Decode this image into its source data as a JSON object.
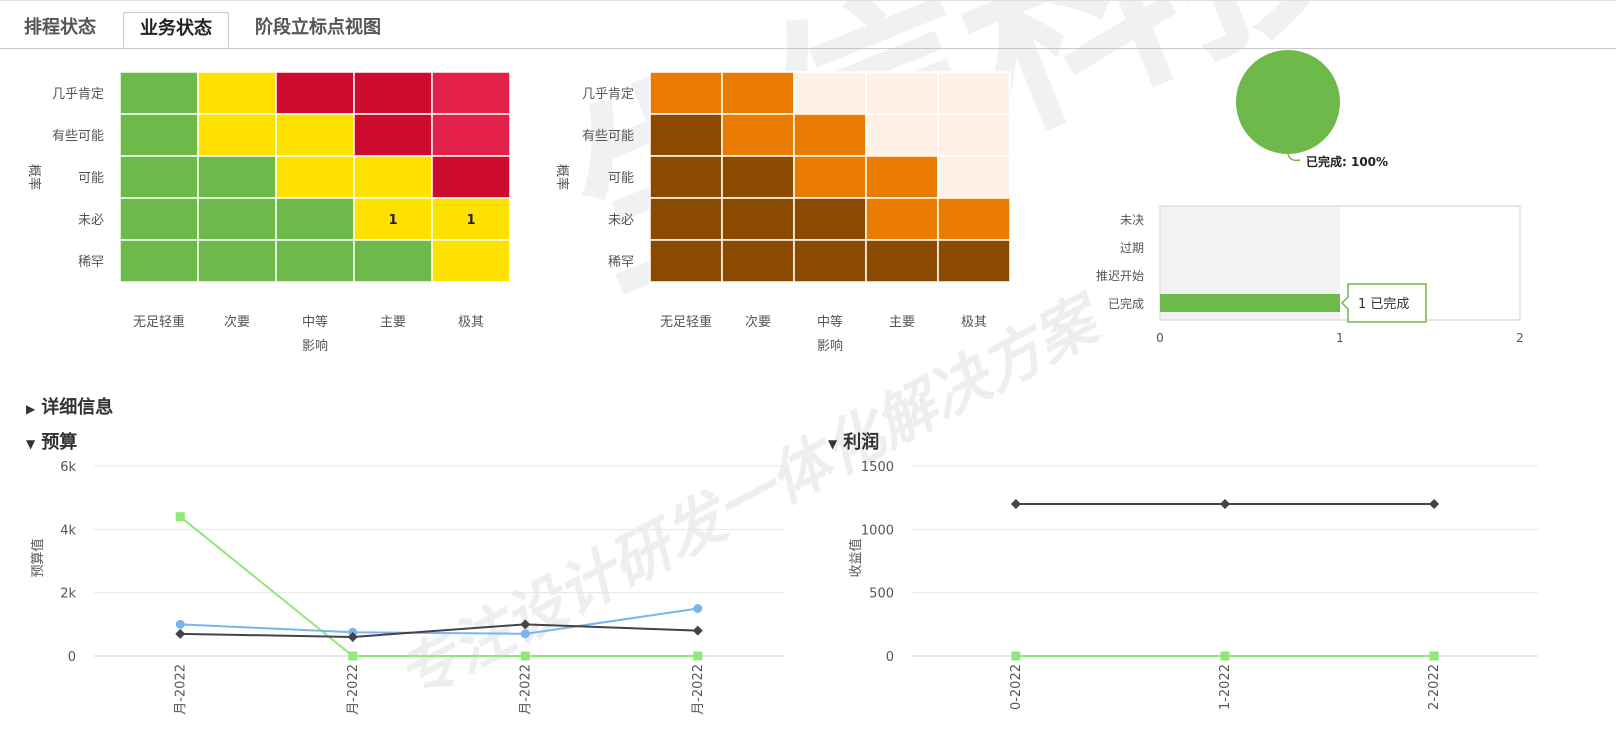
{
  "tabs": [
    {
      "label": "排程状态",
      "active": false
    },
    {
      "label": "业务状态",
      "active": true
    },
    {
      "label": "阶段立标点视图",
      "active": false
    }
  ],
  "watermark": {
    "big": "生信科技",
    "script": "专注设计研发一体化解决方案"
  },
  "heatmaps": [
    {
      "ylabel": "概率",
      "xlabel": "影响",
      "rows": [
        "几乎肯定",
        "有些可能",
        "可能",
        "未必",
        "稀罕"
      ],
      "cols": [
        "无足轻重",
        "次要",
        "中等",
        "主要",
        "极其"
      ],
      "colors": [
        [
          "#6db94a",
          "#ffe100",
          "#cc0b2e",
          "#cc0b2e",
          "#e2204a"
        ],
        [
          "#6db94a",
          "#ffe100",
          "#ffe100",
          "#cc0b2e",
          "#e2204a"
        ],
        [
          "#6db94a",
          "#6db94a",
          "#ffe100",
          "#ffe100",
          "#cc0b2e"
        ],
        [
          "#6db94a",
          "#6db94a",
          "#6db94a",
          "#ffe100",
          "#ffe100"
        ],
        [
          "#6db94a",
          "#6db94a",
          "#6db94a",
          "#6db94a",
          "#ffe100"
        ]
      ],
      "labels": [
        [
          "",
          "",
          "",
          "",
          ""
        ],
        [
          "",
          "",
          "",
          "",
          ""
        ],
        [
          "",
          "",
          "",
          "",
          ""
        ],
        [
          "",
          "",
          "",
          "1",
          "1"
        ],
        [
          "",
          "",
          "",
          "",
          ""
        ]
      ]
    },
    {
      "ylabel": "概率",
      "xlabel": "影响",
      "rows": [
        "几乎肯定",
        "有些可能",
        "可能",
        "未必",
        "稀罕"
      ],
      "cols": [
        "无足轻重",
        "次要",
        "中等",
        "主要",
        "极其"
      ],
      "colors": [
        [
          "#e87b00",
          "#e87b00",
          "#fff1e6",
          "#fff1e6",
          "#fff1e6"
        ],
        [
          "#8b4a00",
          "#e87b00",
          "#e87b00",
          "#fff1e6",
          "#fff1e6"
        ],
        [
          "#8b4a00",
          "#8b4a00",
          "#e87b00",
          "#e87b00",
          "#fff1e6"
        ],
        [
          "#8b4a00",
          "#8b4a00",
          "#8b4a00",
          "#e87b00",
          "#e87b00"
        ],
        [
          "#8b4a00",
          "#8b4a00",
          "#8b4a00",
          "#8b4a00",
          "#8b4a00"
        ]
      ],
      "labels": [
        [
          "",
          "",
          "",
          "",
          ""
        ],
        [
          "",
          "",
          "",
          "",
          ""
        ],
        [
          "",
          "",
          "",
          "",
          ""
        ],
        [
          "",
          "",
          "",
          "",
          ""
        ],
        [
          "",
          "",
          "",
          "",
          ""
        ]
      ]
    }
  ],
  "pie": {
    "label": "已完成: 100%",
    "color": "#6db94a"
  },
  "status_bar": {
    "categories": [
      "未决",
      "过期",
      "推迟开始",
      "已完成"
    ],
    "values": [
      0,
      0,
      0,
      1
    ],
    "ticks": [
      "0",
      "1",
      "2"
    ],
    "xmax": 2,
    "tooltip": "1 已完成",
    "color": "#6db94a"
  },
  "sections": {
    "details": "详细信息",
    "budget": "预算",
    "profit": "利润"
  },
  "chart_data": [
    {
      "type": "line",
      "title": "预算",
      "ylabel": "预算值",
      "ylim": [
        0,
        6000
      ],
      "yticks": [
        "0",
        "2k",
        "4k",
        "6k"
      ],
      "categories": [
        "月-2022",
        "月-2022",
        "月-2022",
        "月-2022"
      ],
      "series": [
        {
          "values": [
            4400,
            0,
            0,
            0
          ],
          "color": "#90e87a",
          "marker": "square"
        },
        {
          "values": [
            1000,
            750,
            700,
            1500
          ],
          "color": "#7cb5ec",
          "marker": "circle"
        },
        {
          "values": [
            700,
            600,
            1000,
            800
          ],
          "color": "#434348",
          "marker": "diamond"
        }
      ]
    },
    {
      "type": "line",
      "title": "利润",
      "ylabel": "收益值",
      "ylim": [
        0,
        1500
      ],
      "yticks": [
        "0",
        "500",
        "1000",
        "1500"
      ],
      "categories": [
        "0-2022",
        "1-2022",
        "2-2022"
      ],
      "series": [
        {
          "values": [
            1200,
            1200,
            1200
          ],
          "color": "#434348",
          "marker": "diamond"
        },
        {
          "values": [
            0,
            0,
            0
          ],
          "color": "#90e87a",
          "marker": "square"
        }
      ]
    }
  ]
}
